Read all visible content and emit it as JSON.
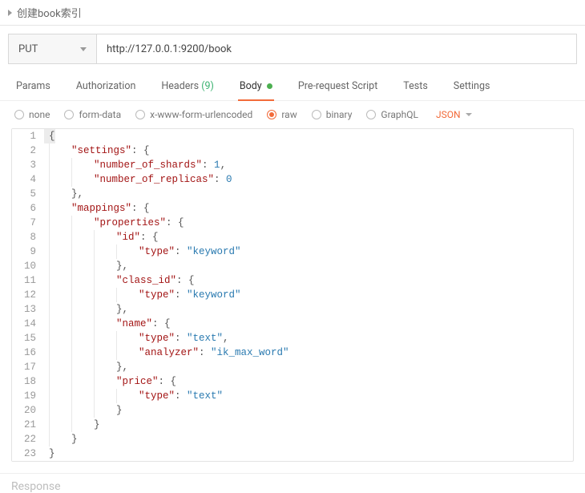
{
  "request": {
    "title": "创建book索引",
    "method": "PUT",
    "url": "http://127.0.0.1:9200/book"
  },
  "tabs": {
    "params": "Params",
    "authorization": "Authorization",
    "headers": "Headers",
    "headers_count": "(9)",
    "body": "Body",
    "prerequest": "Pre-request Script",
    "tests": "Tests",
    "settings": "Settings"
  },
  "body_types": {
    "none": "none",
    "form_data": "form-data",
    "x_www": "x-www-form-urlencoded",
    "raw": "raw",
    "binary": "binary",
    "graphql": "GraphQL"
  },
  "body_format_label": "JSON",
  "editor_lines": [
    {
      "n": 1,
      "indent": 0,
      "tokens": [
        {
          "t": "p",
          "v": "{"
        }
      ]
    },
    {
      "n": 2,
      "indent": 1,
      "tokens": [
        {
          "t": "k",
          "v": "\"settings\""
        },
        {
          "t": "p",
          "v": ": {"
        }
      ]
    },
    {
      "n": 3,
      "indent": 2,
      "tokens": [
        {
          "t": "k",
          "v": "\"number_of_shards\""
        },
        {
          "t": "p",
          "v": ": "
        },
        {
          "t": "n",
          "v": "1"
        },
        {
          "t": "p",
          "v": ","
        }
      ]
    },
    {
      "n": 4,
      "indent": 2,
      "tokens": [
        {
          "t": "k",
          "v": "\"number_of_replicas\""
        },
        {
          "t": "p",
          "v": ": "
        },
        {
          "t": "n",
          "v": "0"
        }
      ]
    },
    {
      "n": 5,
      "indent": 1,
      "tokens": [
        {
          "t": "p",
          "v": "},"
        }
      ]
    },
    {
      "n": 6,
      "indent": 1,
      "tokens": [
        {
          "t": "k",
          "v": "\"mappings\""
        },
        {
          "t": "p",
          "v": ": {"
        }
      ]
    },
    {
      "n": 7,
      "indent": 2,
      "tokens": [
        {
          "t": "k",
          "v": "\"properties\""
        },
        {
          "t": "p",
          "v": ": {"
        }
      ]
    },
    {
      "n": 8,
      "indent": 3,
      "tokens": [
        {
          "t": "k",
          "v": "\"id\""
        },
        {
          "t": "p",
          "v": ": {"
        }
      ]
    },
    {
      "n": 9,
      "indent": 4,
      "tokens": [
        {
          "t": "k",
          "v": "\"type\""
        },
        {
          "t": "p",
          "v": ": "
        },
        {
          "t": "s",
          "v": "\"keyword\""
        }
      ]
    },
    {
      "n": 10,
      "indent": 3,
      "tokens": [
        {
          "t": "p",
          "v": "},"
        }
      ]
    },
    {
      "n": 11,
      "indent": 3,
      "tokens": [
        {
          "t": "k",
          "v": "\"class_id\""
        },
        {
          "t": "p",
          "v": ": {"
        }
      ]
    },
    {
      "n": 12,
      "indent": 4,
      "tokens": [
        {
          "t": "k",
          "v": "\"type\""
        },
        {
          "t": "p",
          "v": ": "
        },
        {
          "t": "s",
          "v": "\"keyword\""
        }
      ]
    },
    {
      "n": 13,
      "indent": 3,
      "tokens": [
        {
          "t": "p",
          "v": "},"
        }
      ]
    },
    {
      "n": 14,
      "indent": 3,
      "tokens": [
        {
          "t": "k",
          "v": "\"name\""
        },
        {
          "t": "p",
          "v": ": {"
        }
      ]
    },
    {
      "n": 15,
      "indent": 4,
      "tokens": [
        {
          "t": "k",
          "v": "\"type\""
        },
        {
          "t": "p",
          "v": ": "
        },
        {
          "t": "s",
          "v": "\"text\""
        },
        {
          "t": "p",
          "v": ","
        }
      ]
    },
    {
      "n": 16,
      "indent": 4,
      "tokens": [
        {
          "t": "k",
          "v": "\"analyzer\""
        },
        {
          "t": "p",
          "v": ": "
        },
        {
          "t": "s",
          "v": "\"ik_max_word\""
        }
      ]
    },
    {
      "n": 17,
      "indent": 3,
      "tokens": [
        {
          "t": "p",
          "v": "},"
        }
      ]
    },
    {
      "n": 18,
      "indent": 3,
      "tokens": [
        {
          "t": "k",
          "v": "\"price\""
        },
        {
          "t": "p",
          "v": ": {"
        }
      ]
    },
    {
      "n": 19,
      "indent": 4,
      "tokens": [
        {
          "t": "k",
          "v": "\"type\""
        },
        {
          "t": "p",
          "v": ": "
        },
        {
          "t": "s",
          "v": "\"text\""
        }
      ]
    },
    {
      "n": 20,
      "indent": 3,
      "tokens": [
        {
          "t": "p",
          "v": "}"
        }
      ]
    },
    {
      "n": 21,
      "indent": 2,
      "tokens": [
        {
          "t": "p",
          "v": "}"
        }
      ]
    },
    {
      "n": 22,
      "indent": 1,
      "tokens": [
        {
          "t": "p",
          "v": "}"
        }
      ]
    },
    {
      "n": 23,
      "indent": 0,
      "tokens": [
        {
          "t": "p",
          "v": "}"
        }
      ]
    }
  ],
  "response_label": "Response"
}
